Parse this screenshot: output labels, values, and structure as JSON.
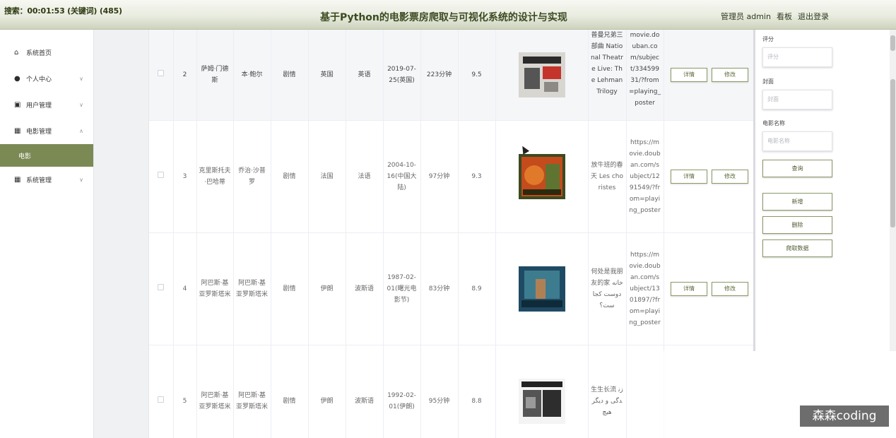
{
  "header": {
    "search_status": "搜索：00:01:53 (关键词) (485)",
    "title": "基于Python的电影票房爬取与可视化系统的设计与实现",
    "admin": "管理员 admin",
    "board": "看板",
    "logout": "退出登录"
  },
  "sidebar": {
    "items": [
      {
        "label": "系统首页",
        "icon": "home-icon"
      },
      {
        "label": "个人中心",
        "icon": "user-icon"
      },
      {
        "label": "用户管理",
        "icon": "clipboard-icon"
      },
      {
        "label": "电影管理",
        "icon": "grid-icon"
      },
      {
        "label": "电影",
        "icon": ""
      },
      {
        "label": "系统管理",
        "icon": "grid-icon"
      }
    ]
  },
  "table": {
    "rows": [
      {
        "index": "2",
        "director": "萨姆·门德斯",
        "writer": "本·鲍尔",
        "genre": "剧情",
        "region": "英国",
        "language": "英语",
        "date": "2019-07-25(英国)",
        "runtime": "223分钟",
        "score": "9.5",
        "name": "普曼兄弟三部曲 National Theatre Live: The Lehman Trilogy",
        "url": "movie.douban.com/subject/33459931/?from=playing_poster",
        "poster": "poster-1"
      },
      {
        "index": "3",
        "director": "克里斯托夫·巴哈蒂",
        "writer": "乔治·沙普罗",
        "genre": "剧情",
        "region": "法国",
        "language": "法语",
        "date": "2004-10-16(中国大陆)",
        "runtime": "97分钟",
        "score": "9.3",
        "name": "放牛班的春天 Les choristes",
        "url": "https://movie.douban.com/subject/1291549/?from=playing_poster",
        "poster": "poster-2"
      },
      {
        "index": "4",
        "director": "阿巴斯·基亚罗斯塔米",
        "writer": "阿巴斯·基亚罗斯塔米",
        "genre": "剧情",
        "region": "伊朗",
        "language": "波斯语",
        "date": "1987-02-01(曙光电影节)",
        "runtime": "83分钟",
        "score": "8.9",
        "name": "何处是我朋友的家 خانه دوست کجاست؟",
        "url": "https://movie.douban.com/subject/1301897/?from=playing_poster",
        "poster": "poster-3"
      },
      {
        "index": "5",
        "director": "阿巴斯·基亚罗斯塔米",
        "writer": "阿巴斯·基亚罗斯塔米",
        "genre": "剧情",
        "region": "伊朗",
        "language": "波斯语",
        "date": "1992-02-01(伊朗)",
        "runtime": "95分钟",
        "score": "8.8",
        "name": "生生长流 زندگی و دیگر هیچ",
        "url": "",
        "poster": "poster-4"
      }
    ],
    "detail_label": "详情",
    "edit_label": "修改"
  },
  "panel": {
    "score_label": "评分",
    "score_placeholder": "评分",
    "cover_label": "封面",
    "cover_placeholder": "封面",
    "name_label": "电影名称",
    "name_placeholder": "电影名称",
    "query": "查询",
    "add": "新增",
    "delete": "删除",
    "crawl": "爬取数据"
  },
  "watermark": "森森coding"
}
